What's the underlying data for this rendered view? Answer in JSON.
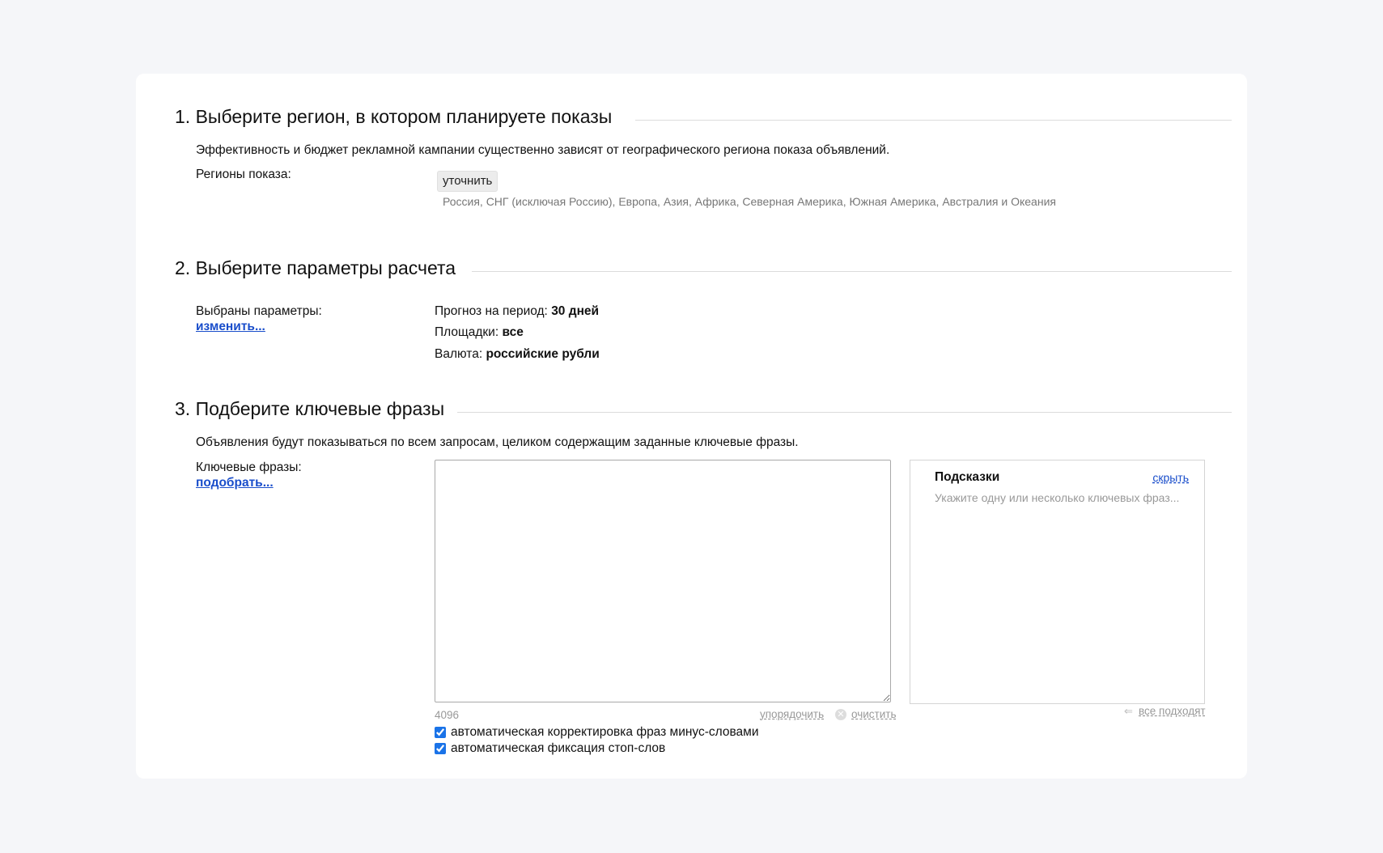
{
  "section1": {
    "title": "1. Выберите регион, в котором планируете показы",
    "description": "Эффективность и бюджет рекламной кампании существенно зависят от географического региона показа объявлений.",
    "regions_label": "Регионы показа:",
    "refine_button": "уточнить",
    "regions_value": "Россия, СНГ (исключая Россию), Европа, Азия, Африка, Северная Америка, Южная Америка, Австралия и Океания"
  },
  "section2": {
    "title": "2. Выберите параметры расчета",
    "selected_label": "Выбраны параметры:",
    "change_link": "изменить...",
    "params": [
      {
        "label": "Прогноз на период:",
        "value": "30 дней"
      },
      {
        "label": "Площадки:",
        "value": "все"
      },
      {
        "label": "Валюта:",
        "value": "российские рубли"
      }
    ]
  },
  "section3": {
    "title": "3. Подберите ключевые фразы",
    "description": "Объявления будут показываться по всем запросам, целиком содержащим заданные ключевые фразы.",
    "keywords_label": "Ключевые фразы:",
    "pick_link": "подобрать...",
    "keywords_value": "",
    "char_counter": "4096",
    "sort_action": "упорядочить",
    "clear_action": "очистить",
    "hints": {
      "title": "Подсказки",
      "hide_link": "скрыть",
      "placeholder": "Укажите одну или несколько ключевых фраз...",
      "all_fit_link": "все подходят"
    },
    "checkboxes": [
      {
        "label": "автоматическая корректировка фраз минус-словами",
        "checked": true
      },
      {
        "label": "автоматическая фиксация стоп-слов",
        "checked": true
      }
    ]
  },
  "icons": {
    "clear": "x-circle-icon",
    "all_fit": "arrow-left-icon"
  },
  "colors": {
    "link": "#1a4ecb",
    "background": "#f5f6f9",
    "card": "#ffffff"
  }
}
